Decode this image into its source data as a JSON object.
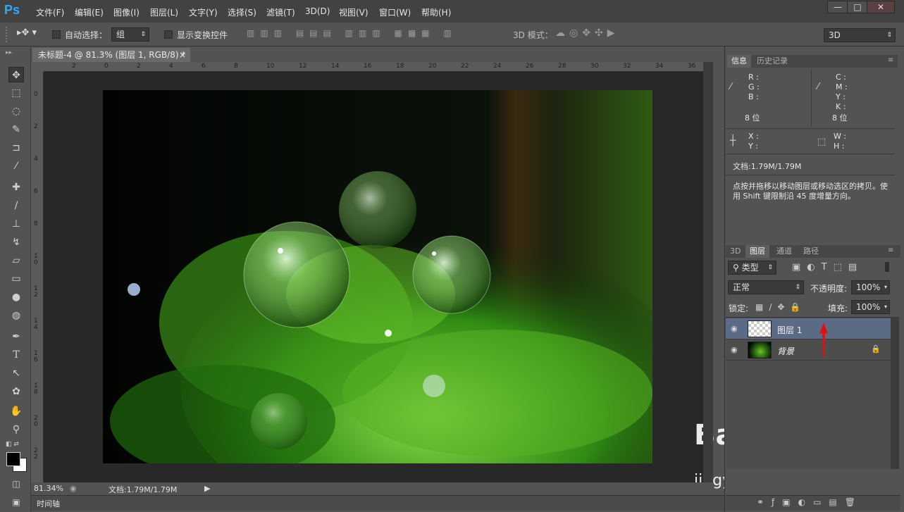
{
  "app": {
    "logo": "Ps"
  },
  "menu": [
    "文件(F)",
    "编辑(E)",
    "图像(I)",
    "图层(L)",
    "文字(Y)",
    "选择(S)",
    "滤镜(T)",
    "3D(D)",
    "视图(V)",
    "窗口(W)",
    "帮助(H)"
  ],
  "window_controls": {
    "minimize": "—",
    "maximize": "□",
    "close": "✕"
  },
  "options": {
    "auto_select_label": "自动选择：",
    "auto_select_value": "组",
    "show_transform_label": "显示变换控件",
    "mode_3d_label": "3D 模式：",
    "workspace": "3D"
  },
  "document": {
    "tab_title": "未标题-4 @ 81.3% (图层 1, RGB/8) *",
    "tab_close": "×",
    "ruler_top": [
      "2",
      "0",
      "2",
      "4",
      "6",
      "8",
      "10",
      "12",
      "14",
      "16",
      "18",
      "20",
      "22",
      "24",
      "26",
      "28",
      "30",
      "32",
      "34",
      "36"
    ],
    "ruler_left": [
      "0",
      "2",
      "4",
      "6",
      "8",
      "10",
      "12",
      "14",
      "16",
      "18",
      "20",
      "22"
    ]
  },
  "status": {
    "zoom": "81.34%",
    "doc_size": "文档:1.79M/1.79M"
  },
  "timeline_label": "时间轴",
  "info_panel": {
    "tabs": [
      "信息",
      "历史记录"
    ],
    "rgb": [
      "R :",
      "G :",
      "B :"
    ],
    "cmyk": [
      "C :",
      "M :",
      "Y :",
      "K :"
    ],
    "bits_left": "8 位",
    "bits_right": "8 位",
    "xy": [
      "X :",
      "Y :"
    ],
    "wh": [
      "W :",
      "H :"
    ],
    "doc_size": "文档:1.79M/1.79M",
    "hint": "点按并拖移以移动图层或移动选区的拷贝。使用 Shift 键限制沿 45 度增量方向。"
  },
  "layers_panel": {
    "tabs": [
      "3D",
      "图层",
      "通道",
      "路径"
    ],
    "filter_kind": "类型",
    "blend_mode": "正常",
    "opacity_label": "不透明度:",
    "opacity_value": "100%",
    "lock_label": "锁定:",
    "fill_label": "填充:",
    "fill_value": "100%",
    "layers": [
      {
        "name": "图层 1",
        "selected": true
      },
      {
        "name": "背景",
        "selected": false
      }
    ]
  },
  "watermark": {
    "brand": "Bai du 经验",
    "url": "jingyan.baidu.com"
  },
  "colors": {
    "accent": "#31a8ff",
    "panel_bg": "#535353",
    "selected_layer": "#5b6a85"
  }
}
